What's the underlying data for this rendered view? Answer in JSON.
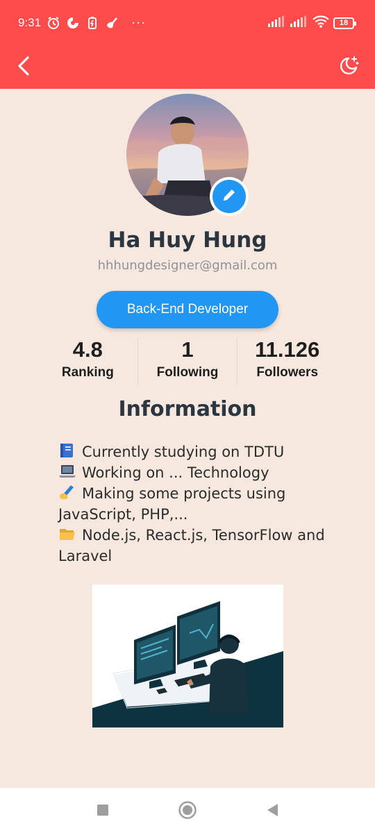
{
  "status_bar": {
    "time": "9:31",
    "more": "···",
    "battery": "18",
    "icons": [
      "alarm-icon",
      "data-saver-icon",
      "battery-saver-icon",
      "cleaner-icon",
      "signal-icon",
      "signal-icon",
      "wifi-icon"
    ]
  },
  "app_bar": {
    "color": "#fe4b4b",
    "back_icon": "chevron-left-icon",
    "theme_icon": "night-mode-icon"
  },
  "profile": {
    "name": "Ha Huy Hung",
    "email": "hhhungdesigner@gmail.com",
    "role": "Back-End Developer",
    "edit_icon": "pencil-icon"
  },
  "stats": [
    {
      "value": "4.8",
      "label": "Ranking"
    },
    {
      "value": "1",
      "label": "Following"
    },
    {
      "value": "11.126",
      "label": "Followers"
    }
  ],
  "information": {
    "title": "Information",
    "lines": [
      {
        "icon": "blue-book-icon",
        "text": "Currently studying on TDTU"
      },
      {
        "icon": "laptop-icon",
        "text": "Working on ... Technology"
      },
      {
        "icon": "writing-hand-icon",
        "text": "Making some projects using JavaScript, PHP,..."
      },
      {
        "icon": "open-folder-icon",
        "text": "Node.js, React.js, TensorFlow and Laravel"
      }
    ]
  },
  "nav_bar": {
    "buttons": [
      "recent-apps-icon",
      "home-icon",
      "back-triangle-icon"
    ]
  },
  "colors": {
    "accent": "#2196f3",
    "header": "#fe4b4b",
    "background": "#f6e8df"
  }
}
